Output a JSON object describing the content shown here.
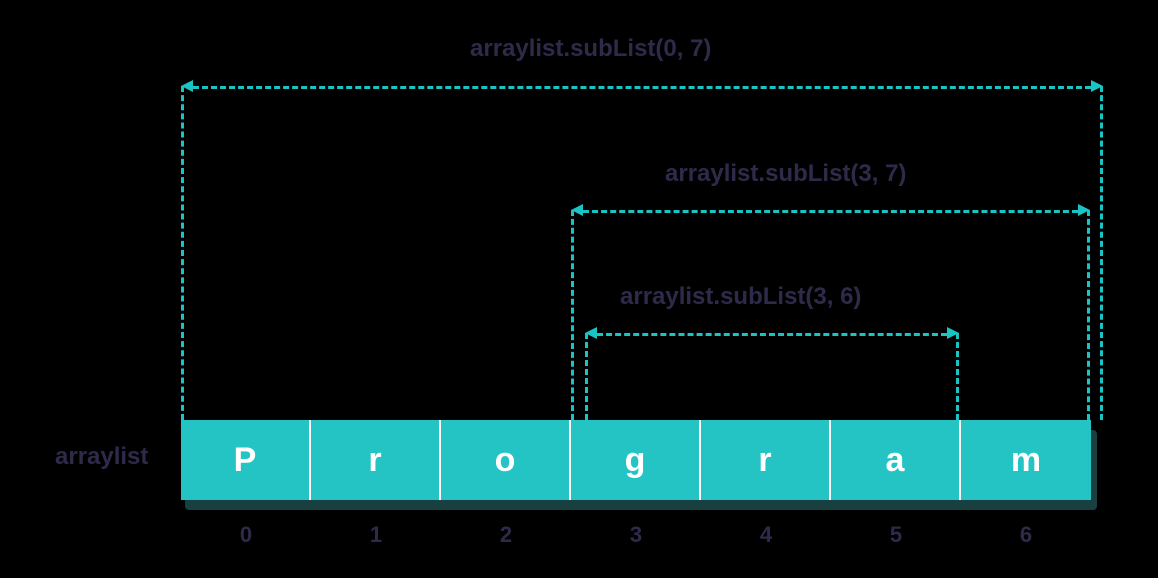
{
  "arrow1": {
    "label": "arraylist.subList(0, 7)"
  },
  "arrow2": {
    "label": "arraylist.subList(3, 7)"
  },
  "arrow3": {
    "label": "arraylist.subList(3, 6)"
  },
  "arrayLabel": "arraylist",
  "cells": [
    "P",
    "r",
    "o",
    "g",
    "r",
    "a",
    "m"
  ],
  "indices": [
    "0",
    "1",
    "2",
    "3",
    "4",
    "5",
    "6"
  ],
  "chart_data": {
    "type": "table",
    "title": "ArrayList subList ranges",
    "array_name": "arraylist",
    "elements": [
      "P",
      "r",
      "o",
      "g",
      "r",
      "a",
      "m"
    ],
    "indices": [
      0,
      1,
      2,
      3,
      4,
      5,
      6
    ],
    "sublists": [
      {
        "call": "arraylist.subList(0, 7)",
        "from": 0,
        "to": 7
      },
      {
        "call": "arraylist.subList(3, 7)",
        "from": 3,
        "to": 7
      },
      {
        "call": "arraylist.subList(3, 6)",
        "from": 3,
        "to": 6
      }
    ]
  }
}
